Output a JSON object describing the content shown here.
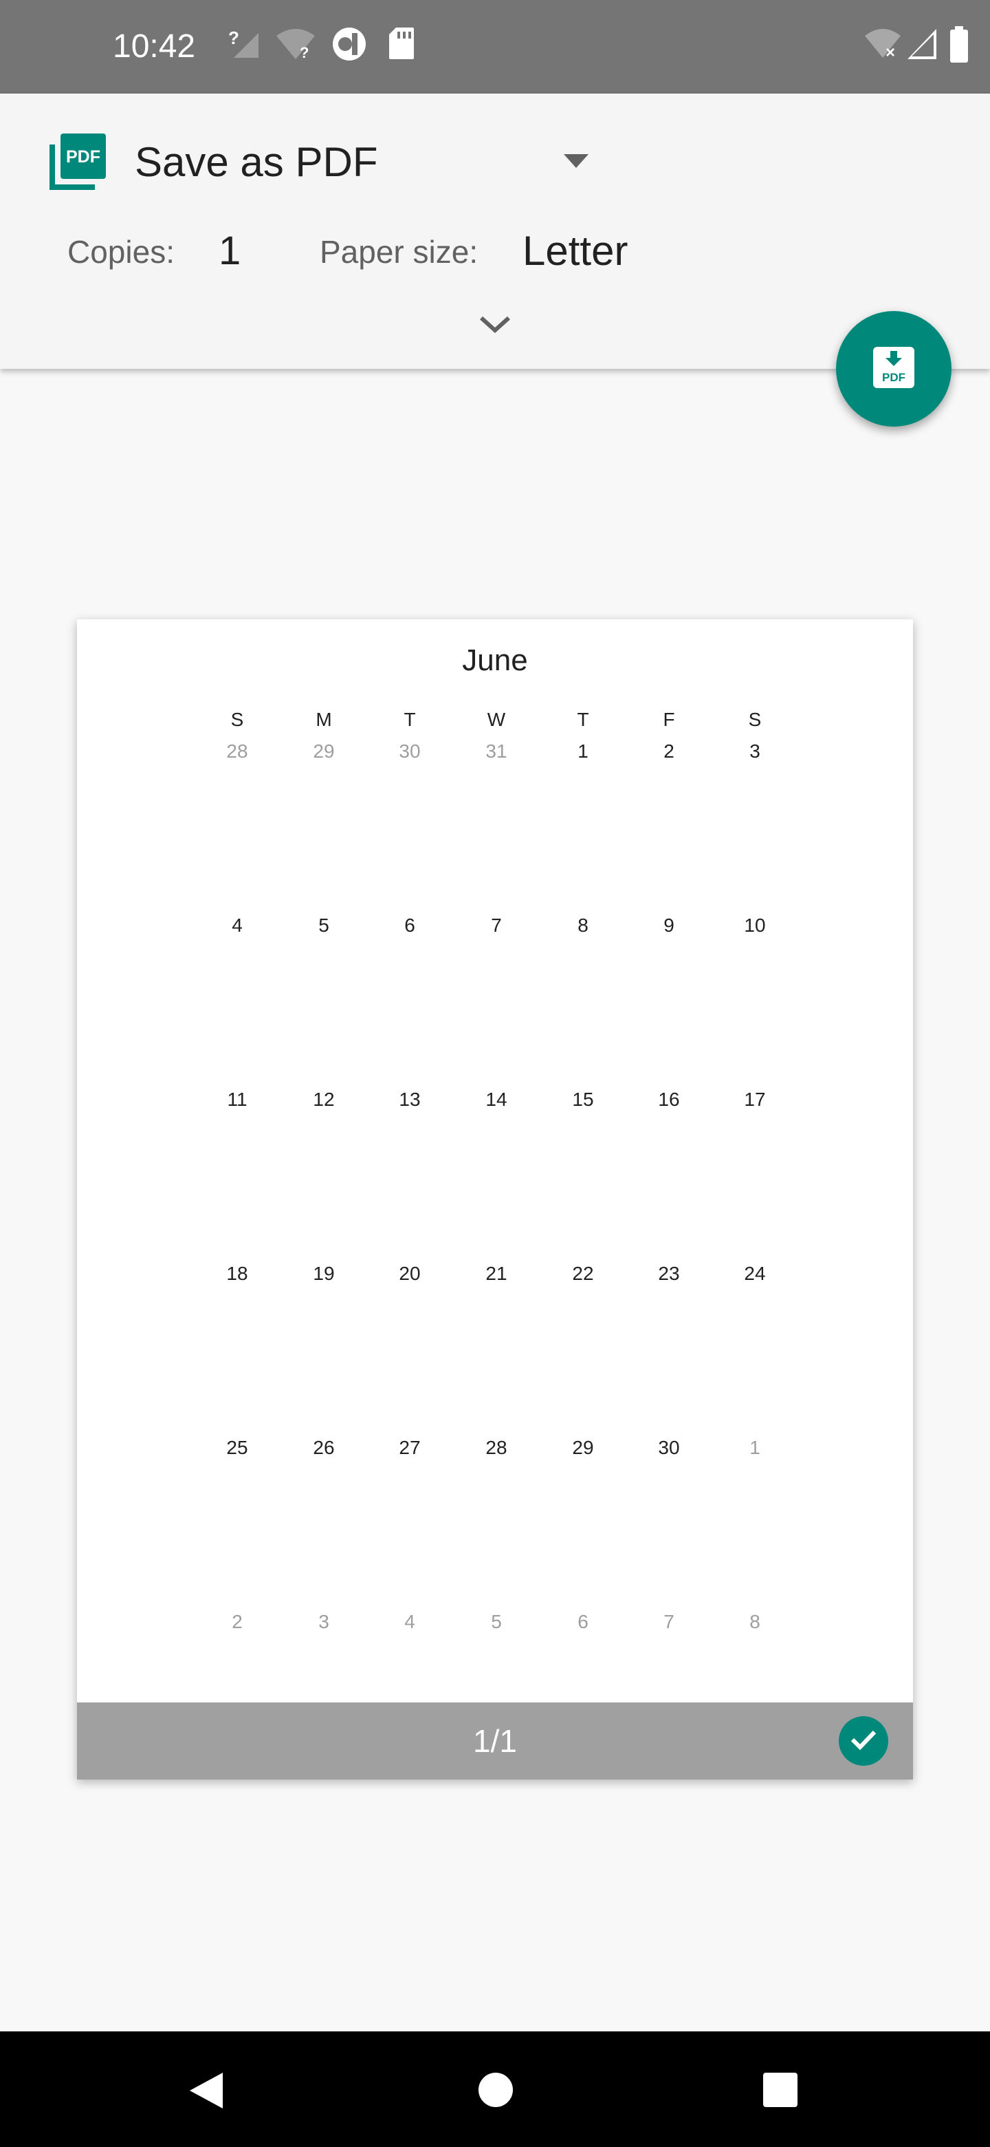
{
  "status_bar": {
    "time": "10:42",
    "icons": [
      "signal-unknown-icon",
      "wifi-unknown-icon",
      "app-notification-icon",
      "sd-card-icon",
      "wifi-off-icon",
      "cell-signal-icon",
      "battery-icon"
    ],
    "background": "#757575"
  },
  "print_header": {
    "printer_name": "Save as PDF",
    "printer_icon": "pdf-icon",
    "copies_label": "Copies:",
    "copies_value": "1",
    "paper_size_label": "Paper size:",
    "paper_size_value": "Letter"
  },
  "fab": {
    "icon": "download-pdf-icon",
    "color": "#00897b"
  },
  "preview": {
    "month": "June",
    "weekdays": [
      "S",
      "M",
      "T",
      "W",
      "T",
      "F",
      "S"
    ],
    "weeks": [
      [
        {
          "d": "28",
          "in_month": false
        },
        {
          "d": "29",
          "in_month": false
        },
        {
          "d": "30",
          "in_month": false
        },
        {
          "d": "31",
          "in_month": false
        },
        {
          "d": "1",
          "in_month": true
        },
        {
          "d": "2",
          "in_month": true
        },
        {
          "d": "3",
          "in_month": true
        }
      ],
      [
        {
          "d": "4",
          "in_month": true
        },
        {
          "d": "5",
          "in_month": true
        },
        {
          "d": "6",
          "in_month": true
        },
        {
          "d": "7",
          "in_month": true
        },
        {
          "d": "8",
          "in_month": true
        },
        {
          "d": "9",
          "in_month": true
        },
        {
          "d": "10",
          "in_month": true
        }
      ],
      [
        {
          "d": "11",
          "in_month": true
        },
        {
          "d": "12",
          "in_month": true
        },
        {
          "d": "13",
          "in_month": true
        },
        {
          "d": "14",
          "in_month": true
        },
        {
          "d": "15",
          "in_month": true
        },
        {
          "d": "16",
          "in_month": true
        },
        {
          "d": "17",
          "in_month": true
        }
      ],
      [
        {
          "d": "18",
          "in_month": true
        },
        {
          "d": "19",
          "in_month": true
        },
        {
          "d": "20",
          "in_month": true
        },
        {
          "d": "21",
          "in_month": true
        },
        {
          "d": "22",
          "in_month": true
        },
        {
          "d": "23",
          "in_month": true
        },
        {
          "d": "24",
          "in_month": true
        }
      ],
      [
        {
          "d": "25",
          "in_month": true
        },
        {
          "d": "26",
          "in_month": true
        },
        {
          "d": "27",
          "in_month": true
        },
        {
          "d": "28",
          "in_month": true
        },
        {
          "d": "29",
          "in_month": true
        },
        {
          "d": "30",
          "in_month": true
        },
        {
          "d": "1",
          "in_month": false
        }
      ],
      [
        {
          "d": "2",
          "in_month": false
        },
        {
          "d": "3",
          "in_month": false
        },
        {
          "d": "4",
          "in_month": false
        },
        {
          "d": "5",
          "in_month": false
        },
        {
          "d": "6",
          "in_month": false
        },
        {
          "d": "7",
          "in_month": false
        },
        {
          "d": "8",
          "in_month": false
        }
      ]
    ],
    "page_indicator": "1/1",
    "page_selected": true
  },
  "nav_bar": {
    "buttons": [
      "back-icon",
      "home-icon",
      "recents-icon"
    ]
  },
  "colors": {
    "accent": "#00897b",
    "header_bg": "#f5f5f5",
    "page_bg": "#f8f8f8",
    "footer_bar": "#a0a0a0"
  }
}
